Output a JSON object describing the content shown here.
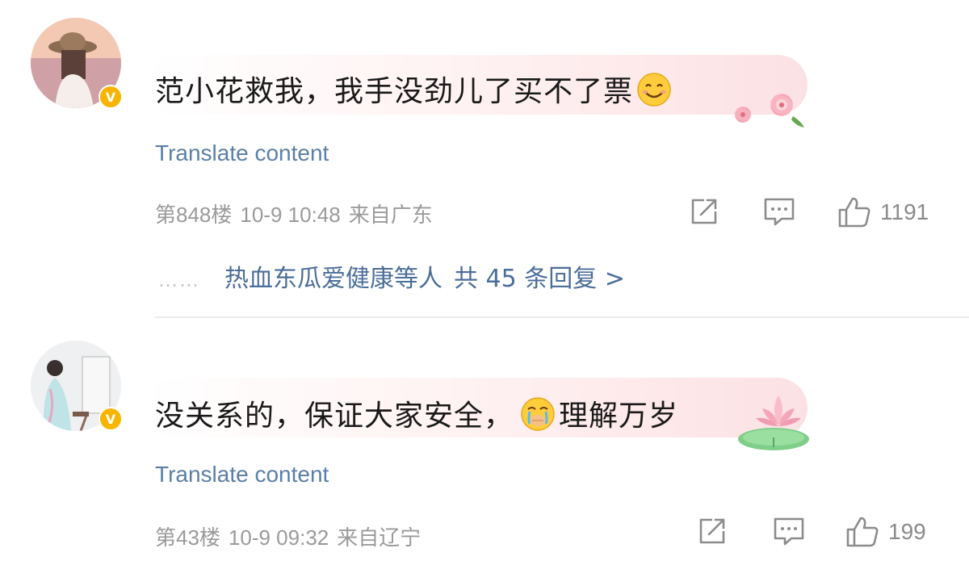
{
  "comments": [
    {
      "text": "范小花救我，我手没劲儿了买不了票",
      "translate_label": "Translate content",
      "floor": "第848楼",
      "time": "10-9 10:48",
      "location": "来自广东",
      "like_count": "1191",
      "badge": "V",
      "replies": {
        "dots": "……",
        "users": "热血东瓜爱健康等人",
        "total": "共 45 条回复 >"
      }
    },
    {
      "text_before": "没关系的，保证大家安全，",
      "text_after": "理解万岁",
      "translate_label": "Translate content",
      "floor": "第43楼",
      "time": "10-9 09:32",
      "location": "来自辽宁",
      "like_count": "199",
      "badge": "V"
    }
  ],
  "colors": {
    "link": "#5b7fa6",
    "reply_link": "#4b6e9a",
    "meta": "#9a9a9a",
    "badge": "#f7b500"
  }
}
